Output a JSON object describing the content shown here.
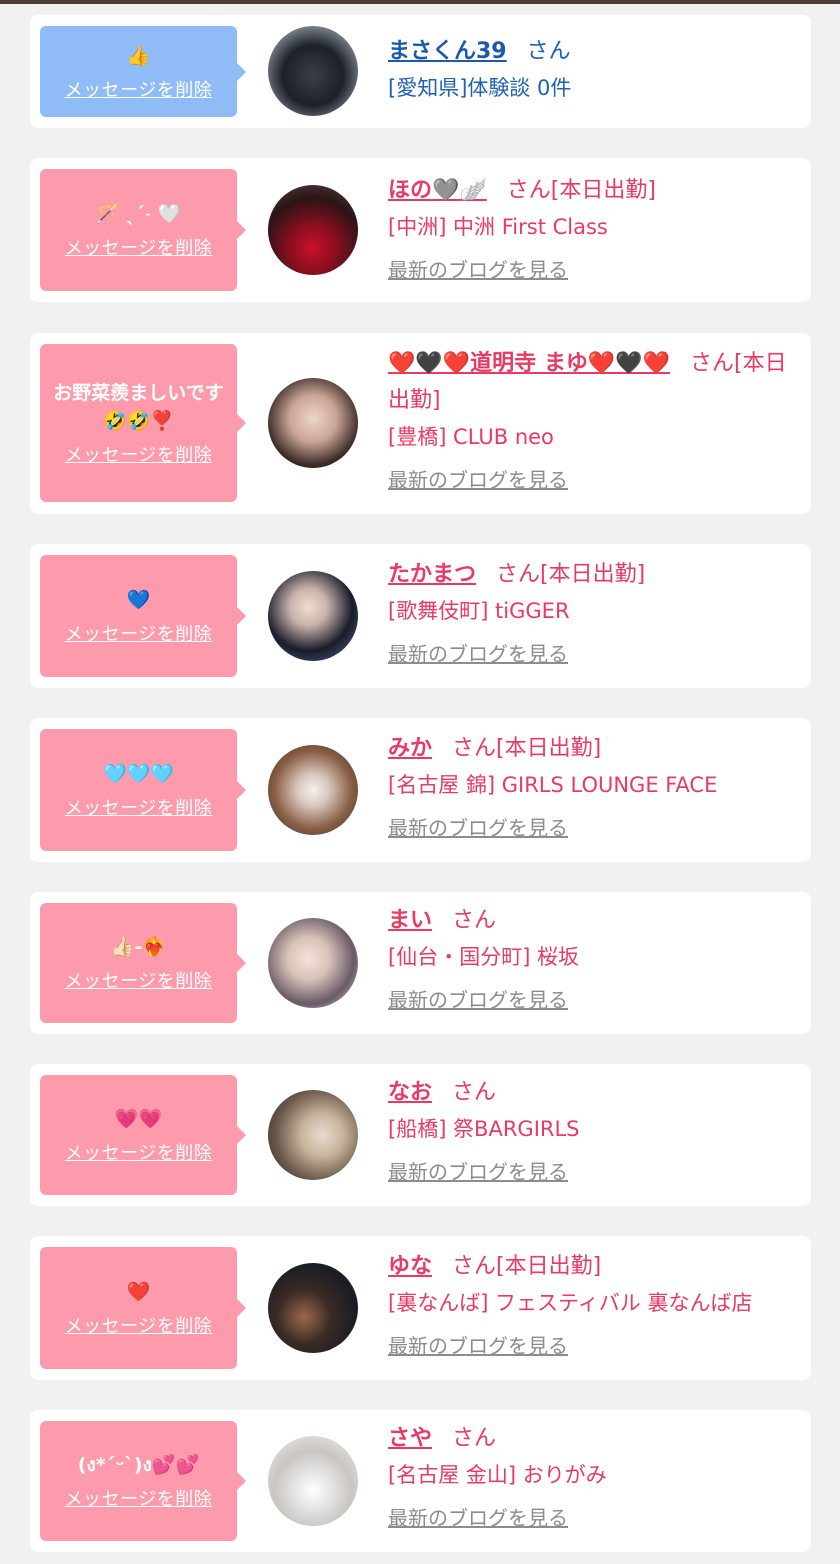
{
  "delete_label": "メッセージを削除",
  "blog_label": "最新のブログを見る",
  "colors": {
    "pink": "#fd9bac",
    "blue": "#8fbcf7",
    "name_pink": "#e83a63",
    "name_blue": "#1a5aa8"
  },
  "items": [
    {
      "message": "👍",
      "name": "まさくん39",
      "suffix": "さん",
      "shop": "[愛知県]体験談 0件",
      "blog": ""
    },
    {
      "message": "🪄 ˎˊ˗ 🤍",
      "name": "ほの🩶🪽",
      "suffix": "さん[本日出勤]",
      "shop": "[中洲] 中洲 First Class",
      "blog": "最新のブログを見る"
    },
    {
      "message": "お野菜羨ましいです🤣🤣❣️",
      "name": "❤️🖤❤️道明寺 まゆ❤️🖤❤️",
      "suffix": "さん[本日出勤]",
      "shop": "[豊橋] CLUB neo",
      "blog": "最新のブログを見る"
    },
    {
      "message": "💙",
      "name": "たかまつ",
      "suffix": "さん[本日出勤]",
      "shop": "[歌舞伎町] tiGGER",
      "blog": "最新のブログを見る"
    },
    {
      "message": "🩵🩵🩵",
      "name": "みか",
      "suffix": "さん[本日出勤]",
      "shop": "[名古屋 錦] GIRLS LOUNGE FACE",
      "blog": "最新のブログを見る"
    },
    {
      "message": "👍🏻-❤️‍🔥",
      "name": "まい",
      "suffix": "さん",
      "shop": "[仙台・国分町] 桜坂",
      "blog": "最新のブログを見る"
    },
    {
      "message": "💗💗",
      "name": "なお",
      "suffix": "さん",
      "shop": "[船橋] 祭BARGIRLS",
      "blog": "最新のブログを見る"
    },
    {
      "message": "❤️",
      "name": "ゆな",
      "suffix": "さん[本日出勤]",
      "shop": "[裏なんば] フェスティバル 裏なんば店",
      "blog": "最新のブログを見る"
    },
    {
      "message": "(ง*ˊᵕˋ)ง💕💕",
      "name": "さや",
      "suffix": "さん",
      "shop": "[名古屋 金山] おりがみ",
      "blog": "最新のブログを見る"
    }
  ]
}
